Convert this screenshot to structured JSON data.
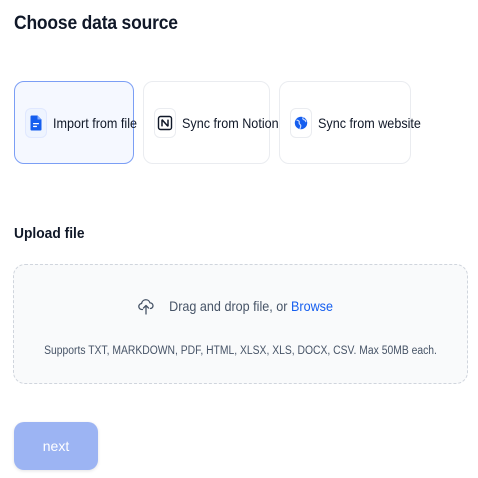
{
  "page": {
    "title": "Choose data source"
  },
  "sources": [
    {
      "label": "Import from file",
      "icon": "file-icon",
      "active": true
    },
    {
      "label": "Sync from Notion",
      "icon": "notion-icon",
      "active": false
    },
    {
      "label": "Sync from website",
      "icon": "globe-icon",
      "active": false
    }
  ],
  "upload": {
    "section_label": "Upload file",
    "drop_text": "Drag and drop file, or ",
    "browse_label": "Browse",
    "hint": "Supports TXT, MARKDOWN, PDF, HTML, XLSX, XLS, DOCX, CSV. Max 50MB each."
  },
  "actions": {
    "next_label": "next"
  },
  "colors": {
    "accent": "#155eef",
    "active_border": "#7b9ef5",
    "button_disabled": "#9cb4f3"
  }
}
